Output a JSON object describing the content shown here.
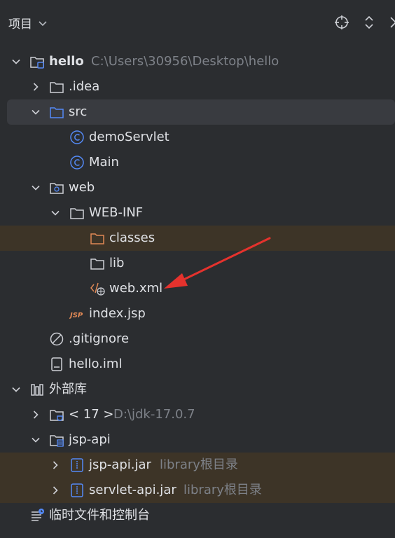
{
  "header": {
    "title": "项目",
    "icons": [
      "chevron-down-icon",
      "locate-icon",
      "expand-collapse-icon",
      "close-icon"
    ]
  },
  "tree": {
    "project": {
      "name": "hello",
      "path": "C:\\Users\\30956\\Desktop\\hello"
    },
    "idea": ".idea",
    "src": "src",
    "demoServlet": "demoServlet",
    "main": "Main",
    "web": "web",
    "webinf": "WEB-INF",
    "classes": "classes",
    "lib": "lib",
    "webxml": "web.xml",
    "indexjsp": "index.jsp",
    "gitignore": ".gitignore",
    "helloiml": "hello.iml",
    "extlibs": "外部库",
    "jdk": {
      "name": "< 17 >",
      "path": "D:\\jdk-17.0.7"
    },
    "jspapi": "jsp-api",
    "jspapijar": {
      "name": "jsp-api.jar",
      "sub": "library根目录"
    },
    "servletapijar": {
      "name": "servlet-api.jar",
      "sub": "library根目录"
    },
    "scratches": "临时文件和控制台"
  },
  "colors": {
    "background": "#2b2d30",
    "selected_row": "#393b40",
    "highlight_row": "#3d3427",
    "folder_blue": "#548af7",
    "folder_orange": "#e08855",
    "annotation_arrow": "#e5322d"
  }
}
